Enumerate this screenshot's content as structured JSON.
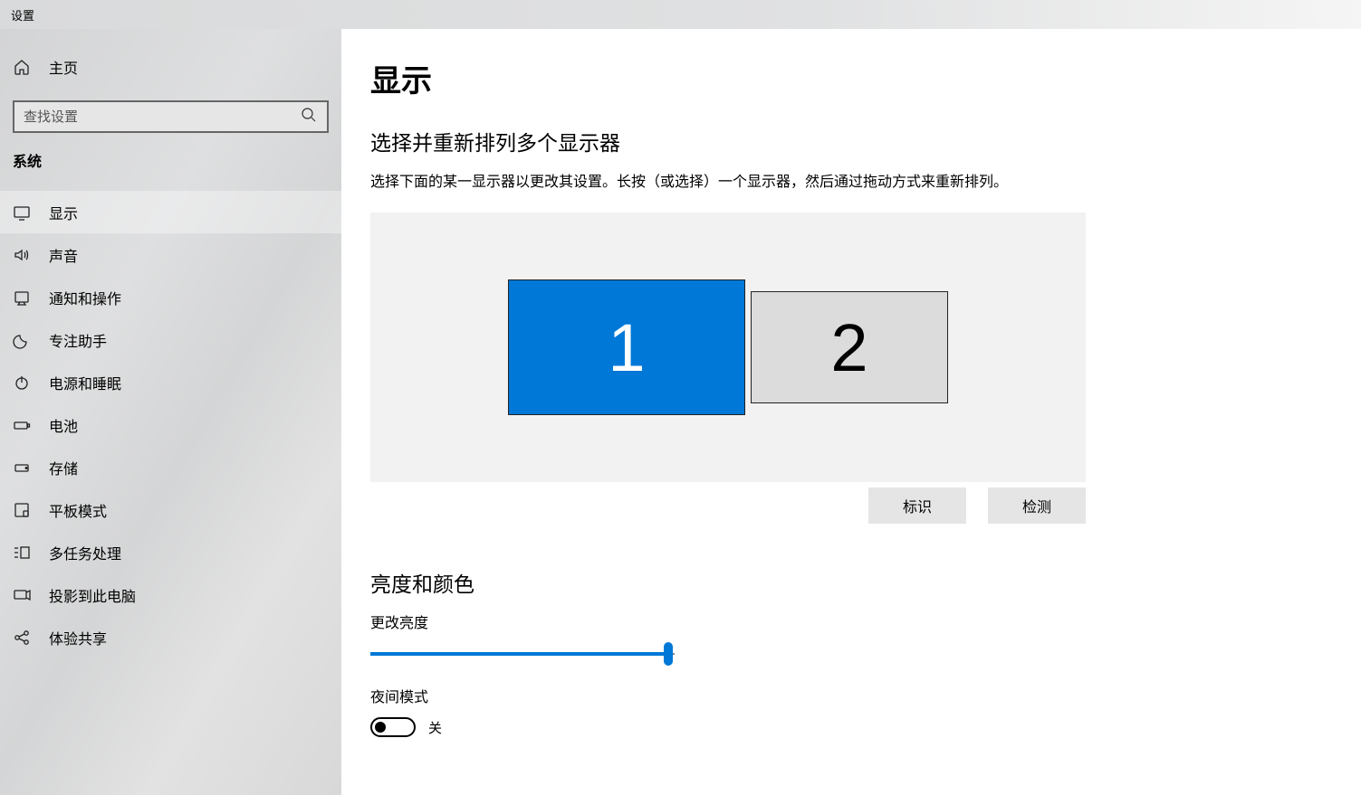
{
  "window": {
    "title": "设置"
  },
  "sidebar": {
    "home": "主页",
    "search_placeholder": "查找设置",
    "category": "系统",
    "items": [
      {
        "icon": "display",
        "label": "显示"
      },
      {
        "icon": "sound",
        "label": "声音"
      },
      {
        "icon": "notifications",
        "label": "通知和操作"
      },
      {
        "icon": "focus",
        "label": "专注助手"
      },
      {
        "icon": "power",
        "label": "电源和睡眠"
      },
      {
        "icon": "battery",
        "label": "电池"
      },
      {
        "icon": "storage",
        "label": "存储"
      },
      {
        "icon": "tablet",
        "label": "平板模式"
      },
      {
        "icon": "multitask",
        "label": "多任务处理"
      },
      {
        "icon": "project",
        "label": "投影到此电脑"
      },
      {
        "icon": "share",
        "label": "体验共享"
      }
    ]
  },
  "main": {
    "title": "显示",
    "arrange_heading": "选择并重新排列多个显示器",
    "arrange_desc": "选择下面的某一显示器以更改其设置。长按（或选择）一个显示器，然后通过拖动方式来重新排列。",
    "monitors": {
      "primary": "1",
      "secondary": "2"
    },
    "identify_btn": "标识",
    "detect_btn": "检测",
    "brightness_heading": "亮度和颜色",
    "brightness_label": "更改亮度",
    "brightness_value": 98,
    "night_label": "夜间模式",
    "night_state": "关"
  }
}
